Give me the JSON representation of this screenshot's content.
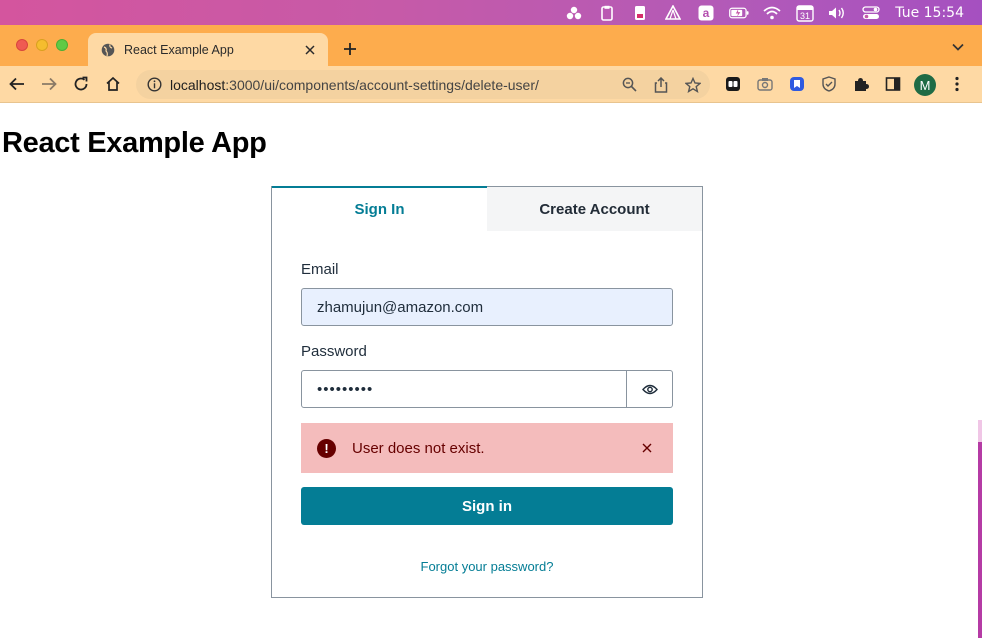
{
  "menubar": {
    "icons": [
      "creative-cloud-icon",
      "clipboard-icon",
      "battery-app-icon",
      "delta-icon",
      "amazon-icon",
      "battery-icon",
      "wifi-icon",
      "calendar-icon",
      "volume-icon",
      "control-center-icon"
    ],
    "calendar_day": "31",
    "amazon_glyph": "a",
    "clock": "Tue 15:54"
  },
  "browser": {
    "tab_title": "React Example App",
    "url_host": "localhost",
    "url_path": ":3000/ui/components/account-settings/delete-user/",
    "profile_initial": "M"
  },
  "page": {
    "heading": "React Example App"
  },
  "auth": {
    "tabs": {
      "signin": "Sign In",
      "create": "Create Account"
    },
    "email_label": "Email",
    "email_value": "zhamujun@amazon.com",
    "password_label": "Password",
    "password_value": "•••••••••",
    "error_icon": "!",
    "error_message": "User does not exist.",
    "submit_label": "Sign in",
    "forgot_link": "Forgot your password?"
  },
  "colors": {
    "accent": "#047d95",
    "error_bg": "#f4bcbc",
    "error_text": "#660000",
    "tabstrip": "#fdac4d",
    "toolbar": "#fed9a4"
  }
}
